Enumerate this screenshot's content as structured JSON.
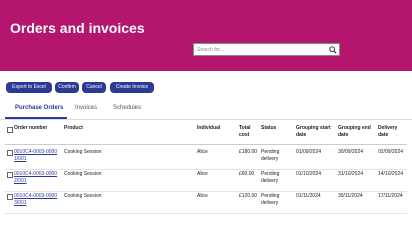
{
  "header": {
    "title": "Orders and invoices",
    "search_placeholder": "Search for...",
    "search_icon": "search-icon",
    "bg_color": "#b4166d"
  },
  "toolbar": {
    "export_label": "Export to Excel",
    "confirm_label": "Confirm",
    "cancel_label": "Cancel",
    "create_invoice_label": "Create Invoice",
    "button_color": "#2b3a94"
  },
  "tabs": [
    {
      "label": "Purchase Orders",
      "active": true
    },
    {
      "label": "Invoices",
      "active": false
    },
    {
      "label": "Schedules",
      "active": false
    }
  ],
  "table": {
    "columns": [
      "Order number",
      "Product",
      "Individual",
      "Total cost",
      "Status",
      "Grouping start date",
      "Grouping end date",
      "Delivery date"
    ],
    "rows": [
      {
        "order": "0010C4-0003-00001/001",
        "product": "Cooking Session",
        "individual": "Alice",
        "total": "£180.00",
        "status": "Pending delivery",
        "start": "01/09/2024",
        "end": "30/09/2024",
        "delivery": "02/09/2024"
      },
      {
        "order": "0010C4-0003-00002/001",
        "product": "Cooking Session",
        "individual": "Alice",
        "total": "£60.00",
        "status": "Pending delivery",
        "start": "01/10/2024",
        "end": "31/10/2024",
        "delivery": "14/10/2024"
      },
      {
        "order": "0010C4-0003-00003/001",
        "product": "Cooking Session",
        "individual": "Alice",
        "total": "£120.00",
        "status": "Pending delivery",
        "start": "01/11/2024",
        "end": "30/11/2024",
        "delivery": "17/11/2024"
      }
    ]
  }
}
